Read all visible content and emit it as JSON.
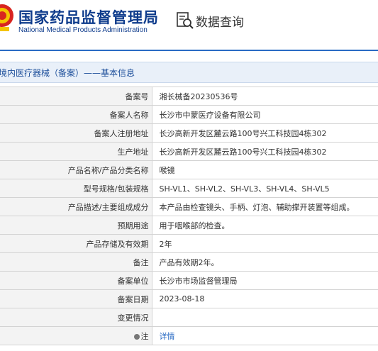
{
  "header": {
    "cn_title": "国家药品监督管理局",
    "en_title": "National Medical Products Administration",
    "query_label": "数据查询",
    "accent_color": "#0f3c8c"
  },
  "breadcrumb": "境内医疗器械（备案）——基本信息",
  "rows": [
    {
      "label": "备案号",
      "value": "湘长械备20230536号"
    },
    {
      "label": "备案人名称",
      "value": "长沙市中蒙医疗设备有限公司"
    },
    {
      "label": "备案人注册地址",
      "value": "长沙高新开发区麓云路100号兴工科技园4栋302"
    },
    {
      "label": "生产地址",
      "value": "长沙高新开发区麓云路100号兴工科技园4栋302"
    },
    {
      "label": "产品名称/产品分类名称",
      "value": "喉镜"
    },
    {
      "label": "型号规格/包装规格",
      "value": "SH-VL1、SH-VL2、SH-VL3、SH-VL4、SH-VL5"
    },
    {
      "label": "产品描述/主要组成成分",
      "value": "本产品由检查镜头、手柄、灯泡、辅助撑开装置等组成。"
    },
    {
      "label": "预期用途",
      "value": "用于咽喉部的检查。"
    },
    {
      "label": "产品存储及有效期",
      "value": "2年"
    },
    {
      "label": "备注",
      "value": "产品有效期2年。"
    },
    {
      "label": "备案单位",
      "value": "长沙市市场监督管理局"
    },
    {
      "label": "备案日期",
      "value": "2023-08-18"
    },
    {
      "label": "变更情况",
      "value": ""
    },
    {
      "label": "注",
      "value": "详情"
    }
  ]
}
